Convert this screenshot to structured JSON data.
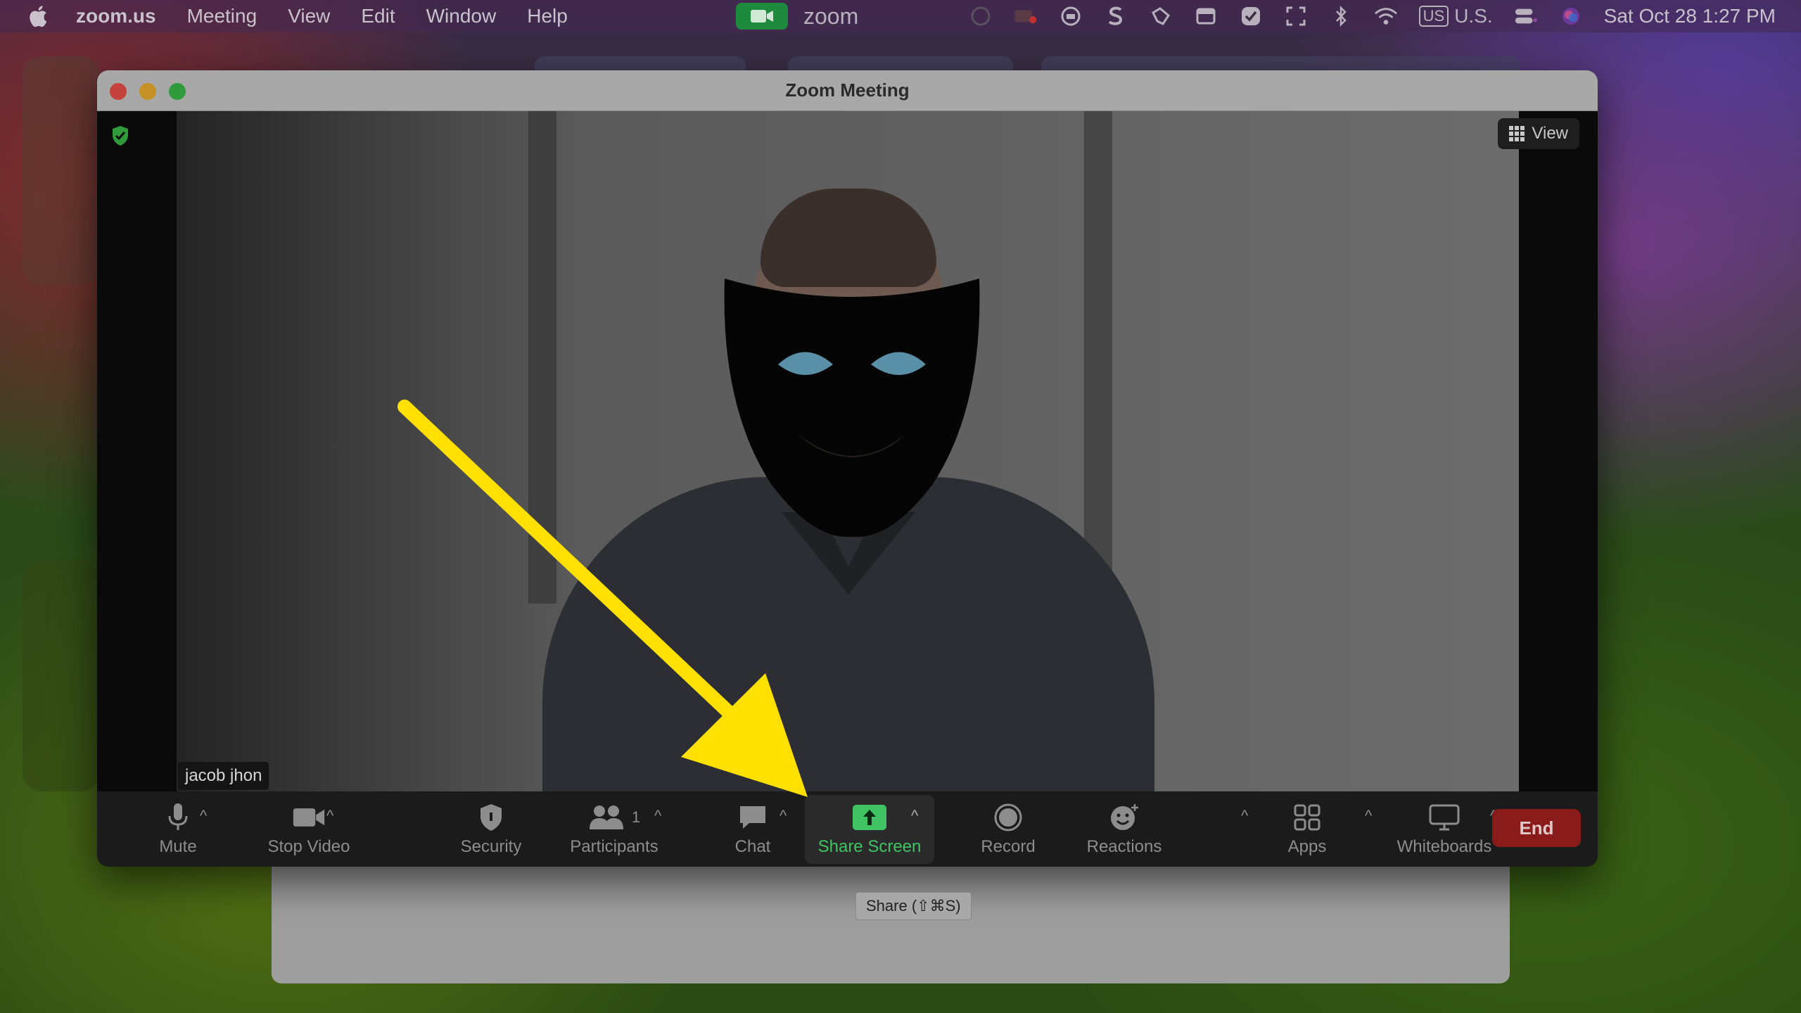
{
  "menubar": {
    "app_name": "zoom.us",
    "items": [
      "Meeting",
      "View",
      "Edit",
      "Window",
      "Help"
    ],
    "zoom_label": "zoom",
    "input_source": "US",
    "input_label": "U.S.",
    "clock": "Sat Oct 28  1:27 PM"
  },
  "window": {
    "title": "Zoom Meeting",
    "view_label": "View",
    "participant_name": "jacob jhon"
  },
  "toolbar": {
    "mute": "Mute",
    "stop_video": "Stop Video",
    "security": "Security",
    "participants": "Participants",
    "participants_count": "1",
    "chat": "Chat",
    "share_screen": "Share Screen",
    "record": "Record",
    "reactions": "Reactions",
    "apps": "Apps",
    "whiteboards": "Whiteboards",
    "end": "End",
    "caret": "^"
  },
  "tooltip": "Share (⇧⌘S)",
  "colors": {
    "share_green": "#40c463",
    "end_red": "#8a1b1b",
    "arrow_yellow": "#ffe000"
  }
}
